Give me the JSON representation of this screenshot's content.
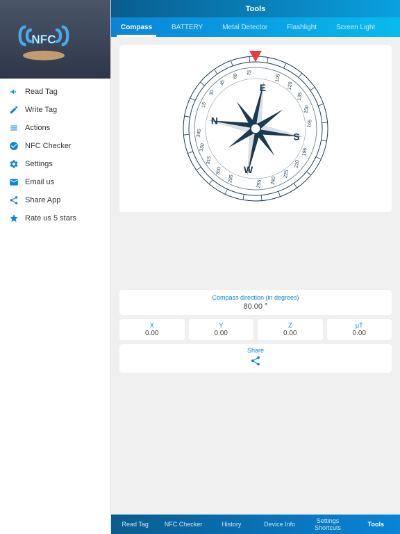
{
  "header": {
    "title": "Tools"
  },
  "sidebar": {
    "items": [
      {
        "icon": "megaphone-icon",
        "label": "Read Tag"
      },
      {
        "icon": "write-icon",
        "label": "Write Tag"
      },
      {
        "icon": "list-icon",
        "label": "Actions"
      },
      {
        "icon": "check-icon",
        "label": "NFC Checker"
      },
      {
        "icon": "gear-icon",
        "label": "Settings"
      },
      {
        "icon": "mail-icon",
        "label": "Email us"
      },
      {
        "icon": "share-icon",
        "label": "Share App"
      },
      {
        "icon": "star-icon",
        "label": "Rate us 5 stars"
      }
    ]
  },
  "tabs": [
    {
      "label": "Compass",
      "active": true
    },
    {
      "label": "BATTERY",
      "active": false
    },
    {
      "label": "Metal Detector",
      "active": false
    },
    {
      "label": "Flashlight",
      "active": false
    },
    {
      "label": "Screen Light",
      "active": false
    }
  ],
  "compass": {
    "direction_label": "Compass direction (in degrees)",
    "direction_value": "80.00 °",
    "readings": [
      {
        "label": "X",
        "value": "0.00"
      },
      {
        "label": "Y",
        "value": "0.00"
      },
      {
        "label": "Z",
        "value": "0.00"
      },
      {
        "label": "µT",
        "value": "0.00"
      }
    ],
    "share_label": "Share"
  },
  "bottom_nav": [
    {
      "label": "Read Tag",
      "active": false
    },
    {
      "label": "NFC Checker",
      "active": false
    },
    {
      "label": "History",
      "active": false
    },
    {
      "label": "Device Info",
      "active": false
    },
    {
      "label": "Settings Shortcuts",
      "active": false
    },
    {
      "label": "Tools",
      "active": true
    }
  ],
  "logo_text": "NFC"
}
